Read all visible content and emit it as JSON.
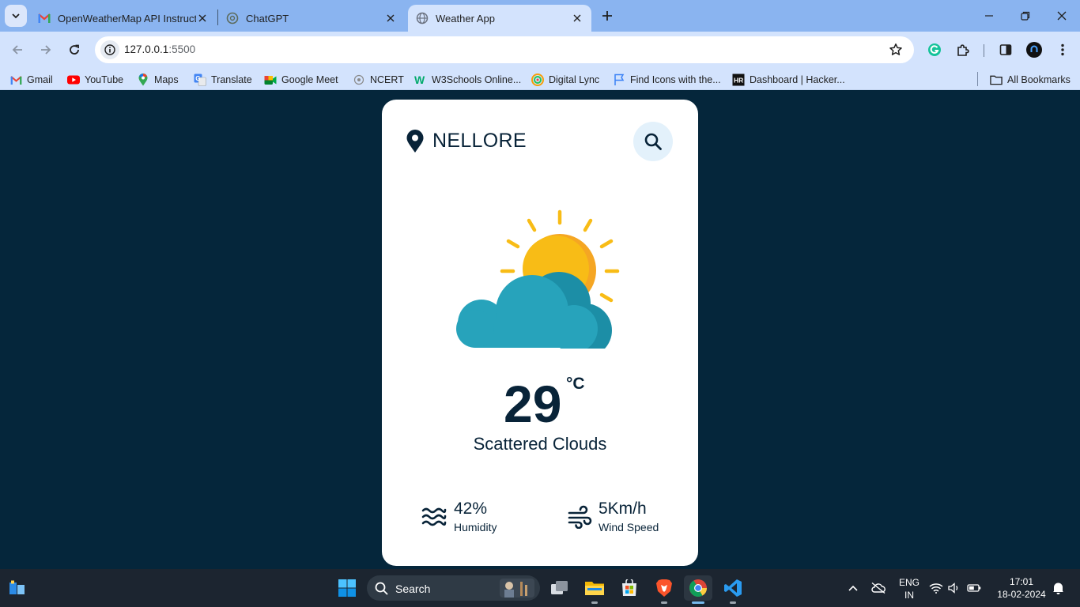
{
  "browser": {
    "tabs": [
      {
        "title": "OpenWeatherMap API Instructio",
        "icon": "gmail-icon"
      },
      {
        "title": "ChatGPT",
        "icon": "chatgpt-icon"
      },
      {
        "title": "Weather App",
        "icon": "globe-icon",
        "active": true
      }
    ],
    "url_host": "127.0.0.1",
    "url_port": ":5500",
    "bookmarks": [
      {
        "label": "Gmail"
      },
      {
        "label": "YouTube"
      },
      {
        "label": "Maps"
      },
      {
        "label": "Translate"
      },
      {
        "label": "Google Meet"
      },
      {
        "label": "NCERT"
      },
      {
        "label": "W3Schools Online..."
      },
      {
        "label": "Digital Lync"
      },
      {
        "label": "Find Icons with the..."
      },
      {
        "label": "Dashboard | Hacker..."
      }
    ],
    "all_bookmarks": "All Bookmarks"
  },
  "weather": {
    "city": "NELLORE",
    "temperature": "29",
    "unit": "°C",
    "description": "Scattered Clouds",
    "humidity_value": "42%",
    "humidity_label": "Humidity",
    "wind_value": "5Km/h",
    "wind_label": "Wind Speed"
  },
  "taskbar": {
    "search_label": "Search",
    "lang_line1": "ENG",
    "lang_line2": "IN",
    "time": "17:01",
    "date": "18-02-2024"
  },
  "colors": {
    "page_background": "#05263b",
    "card_background": "#ffffff",
    "text_dark": "#082338",
    "sun": "#f8bc16",
    "cloud": "#27a3bb"
  }
}
